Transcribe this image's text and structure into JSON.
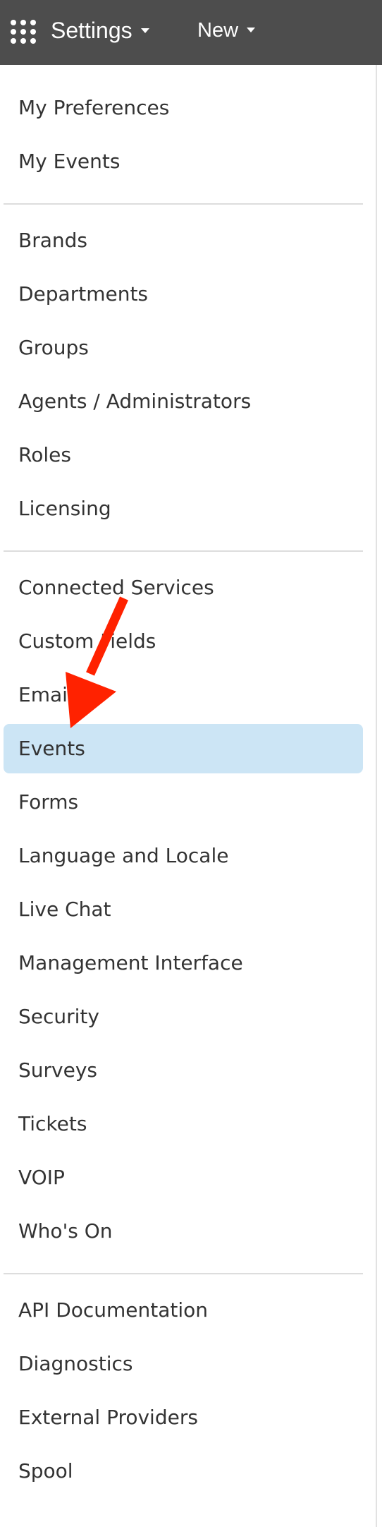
{
  "topbar": {
    "apps_icon": "apps-grid-icon",
    "settings_label": "Settings",
    "new_label": "New",
    "background": "#4d4d4d"
  },
  "sidebar": {
    "sections": [
      {
        "items": [
          {
            "label": "My Preferences"
          },
          {
            "label": "My Events"
          }
        ]
      },
      {
        "items": [
          {
            "label": "Brands"
          },
          {
            "label": "Departments"
          },
          {
            "label": "Groups"
          },
          {
            "label": "Agents / Administrators"
          },
          {
            "label": "Roles"
          },
          {
            "label": "Licensing"
          }
        ]
      },
      {
        "items": [
          {
            "label": "Connected Services"
          },
          {
            "label": "Custom Fields"
          },
          {
            "label": "Email"
          },
          {
            "label": "Events",
            "active": true
          },
          {
            "label": "Forms"
          },
          {
            "label": "Language and Locale"
          },
          {
            "label": "Live Chat"
          },
          {
            "label": "Management Interface"
          },
          {
            "label": "Security"
          },
          {
            "label": "Surveys"
          },
          {
            "label": "Tickets"
          },
          {
            "label": "VOIP"
          },
          {
            "label": "Who's On"
          }
        ]
      },
      {
        "items": [
          {
            "label": "API Documentation"
          },
          {
            "label": "Diagnostics"
          },
          {
            "label": "External Providers"
          },
          {
            "label": "Spool"
          }
        ]
      }
    ],
    "active_color": "#cce5f5",
    "text_color": "#333333"
  },
  "annotation": {
    "type": "arrow",
    "color": "#ff2200",
    "points_to": "Events"
  }
}
